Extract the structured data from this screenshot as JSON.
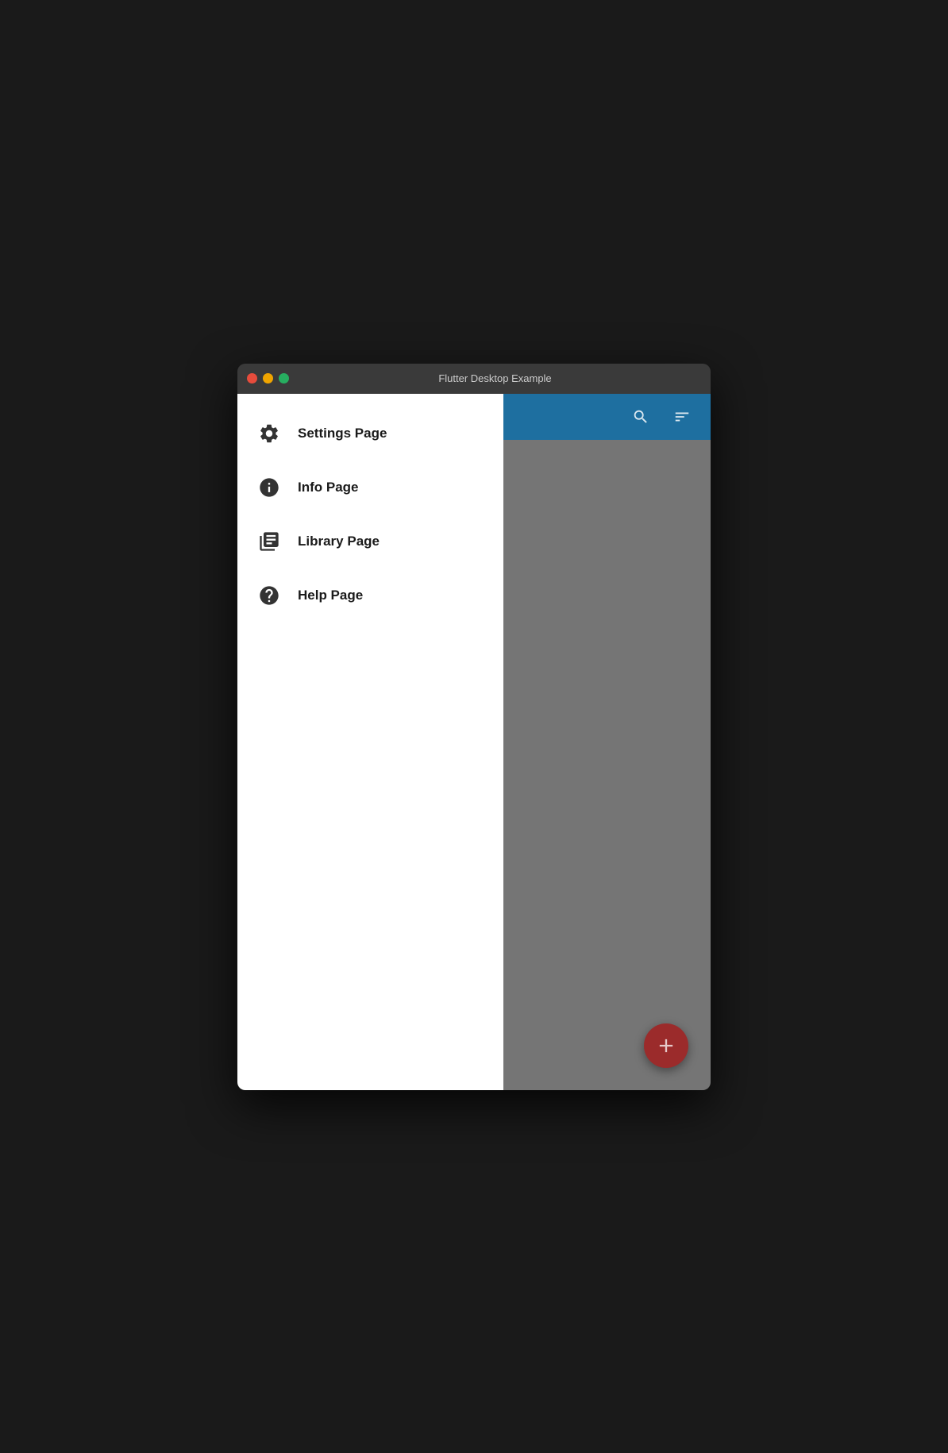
{
  "titlebar": {
    "title": "Flutter Desktop Example"
  },
  "sidebar": {
    "items": [
      {
        "id": "settings",
        "label": "Settings Page",
        "icon": "gear-icon"
      },
      {
        "id": "info",
        "label": "Info Page",
        "icon": "info-icon"
      },
      {
        "id": "library",
        "label": "Library Page",
        "icon": "library-icon"
      },
      {
        "id": "help",
        "label": "Help Page",
        "icon": "help-icon"
      }
    ]
  },
  "header": {
    "search_icon": "🔍",
    "filter_icon": "≡"
  },
  "fab": {
    "label": "+"
  },
  "colors": {
    "titlebar": "#3a3a3a",
    "sidebar_bg": "#ffffff",
    "header_bg": "#1e6fa0",
    "main_bg": "#757575",
    "fab_bg": "#9b2b2b"
  }
}
